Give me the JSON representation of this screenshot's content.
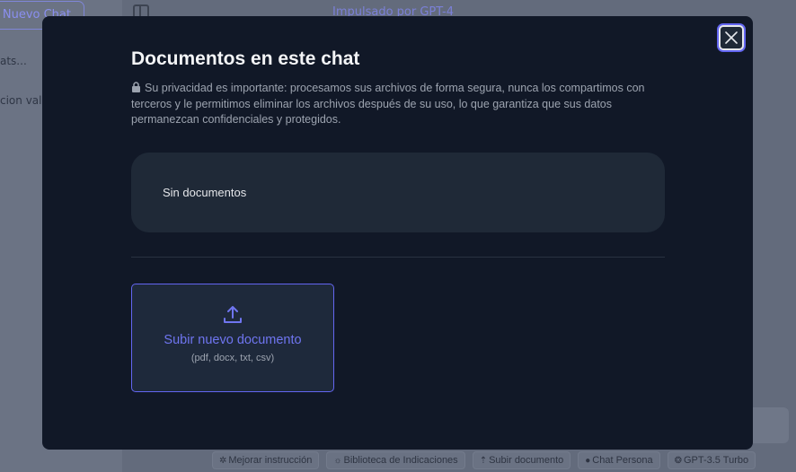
{
  "background": {
    "sidebar": {
      "new_chat_label": "r Nuevo Chat",
      "item1": "ats...",
      "item2": "cion val"
    },
    "header": {
      "title": "Impulsado por GPT-4"
    },
    "toolbar": [
      {
        "label": "Mejorar instrucción",
        "icon": "sparkle-icon"
      },
      {
        "label": "Biblioteca de Indicaciones",
        "icon": "sun-icon"
      },
      {
        "label": "Subir documento",
        "icon": "upload-icon"
      },
      {
        "label": "Chat Persona",
        "icon": "person-icon"
      },
      {
        "label": "GPT-3.5 Turbo",
        "icon": "openai-icon"
      }
    ]
  },
  "modal": {
    "title": "Documentos en este chat",
    "privacy_text": "Su privacidad es importante: procesamos sus archivos de forma segura, nunca los compartimos con terceros y le permitimos eliminar los archivos después de su uso, lo que garantiza que sus datos permanezcan confidenciales y protegidos.",
    "empty_label": "Sin documentos",
    "upload": {
      "label": "Subir nuevo documento",
      "formats": "(pdf, docx, txt, csv)"
    }
  },
  "colors": {
    "modal_bg": "#111827",
    "card_bg": "#1f2937",
    "accent": "#6366f1",
    "muted_text": "#9ca3af"
  }
}
